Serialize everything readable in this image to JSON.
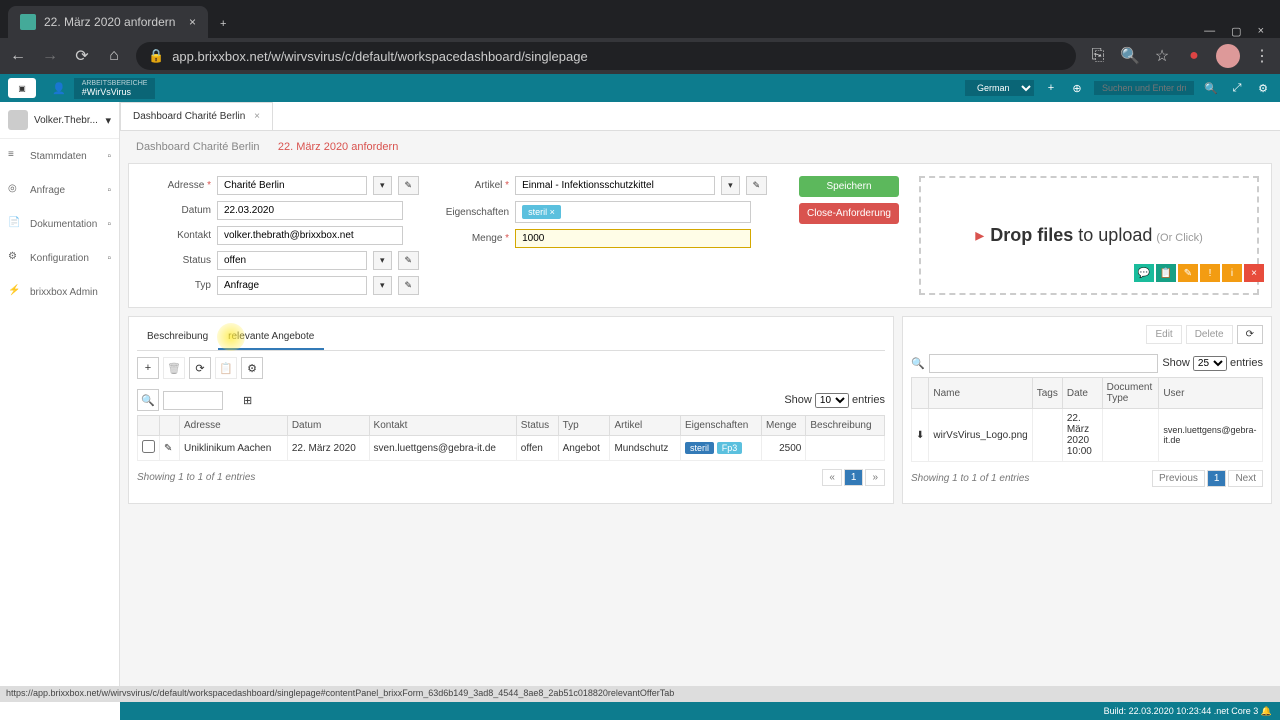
{
  "browser": {
    "tab_title": "22. März 2020 anfordern",
    "url": "app.brixxbox.net/w/wirvsvirus/c/default/workspacedashboard/singlepage"
  },
  "header": {
    "workspace_label": "ARBEITSBEREICHE",
    "workspace_name": "#WirVsVirus",
    "language": "German",
    "search_placeholder": "Suchen und Enter drücken"
  },
  "sidebar": {
    "user": "Volker.Thebr...",
    "items": [
      "Stammdaten",
      "Anfrage",
      "Dokumentation",
      "Konfiguration",
      "brixxbox Admin"
    ]
  },
  "tabs": {
    "main": "Dashboard Charité Berlin"
  },
  "breadcrumb": {
    "parent": "Dashboard Charité Berlin",
    "current": "22. März 2020 anfordern"
  },
  "form": {
    "labels": {
      "adresse": "Adresse",
      "datum": "Datum",
      "kontakt": "Kontakt",
      "status": "Status",
      "typ": "Typ",
      "artikel": "Artikel",
      "eigenschaften": "Eigenschaften",
      "menge": "Menge"
    },
    "values": {
      "adresse": "Charité Berlin",
      "datum": "22.03.2020",
      "kontakt": "volker.thebrath@brixxbox.net",
      "status": "offen",
      "typ": "Anfrage",
      "artikel": "Einmal - Infektionsschutzkittel",
      "eigenschaften_tag": "steril",
      "menge": "1000"
    },
    "buttons": {
      "save": "Speichern",
      "close": "Close-Anforderung"
    }
  },
  "dropzone": {
    "text1": "Drop files",
    "text2": "to upload",
    "orclick": "(Or Click)"
  },
  "subtabs": {
    "beschreibung": "Beschreibung",
    "angebote": "relevante Angebote"
  },
  "table_left": {
    "show": "Show",
    "show_value": "10",
    "entries": "entries",
    "columns": [
      "Adresse",
      "Datum",
      "Kontakt",
      "Status",
      "Typ",
      "Artikel",
      "Eigenschaften",
      "Menge",
      "Beschreibung"
    ],
    "row": {
      "adresse": "Uniklinikum Aachen",
      "datum": "22. März 2020",
      "kontakt": "sven.luettgens@gebra-it.de",
      "status": "offen",
      "typ": "Angebot",
      "artikel": "Mundschutz",
      "eig1": "steril",
      "eig2": "Fp3",
      "menge": "2500",
      "beschreibung": ""
    },
    "footer": "Showing 1 to 1 of 1 entries"
  },
  "panel_right": {
    "edit": "Edit",
    "delete": "Delete",
    "show": "Show",
    "show_value": "25",
    "entries": "entries",
    "columns": [
      "Name",
      "Tags",
      "Date",
      "Document Type",
      "User"
    ],
    "row": {
      "name": "wirVsVirus_Logo.png",
      "date": "22. März 2020 10:00",
      "user": "sven.luettgens@gebra-it.de"
    },
    "footer": "Showing 1 to 1 of 1 entries",
    "prev": "Previous",
    "next": "Next"
  },
  "statusbar": "https://app.brixxbox.net/w/wirvsvirus/c/default/workspacedashboard/singlepage#contentPanel_brixxForm_63d6b149_3ad8_4544_8ae8_2ab51c018820relevantOfferTab",
  "footer": {
    "build": "Build:",
    "timestamp": "22.03.2020 10:23:44",
    "core": ".net Core 3"
  }
}
